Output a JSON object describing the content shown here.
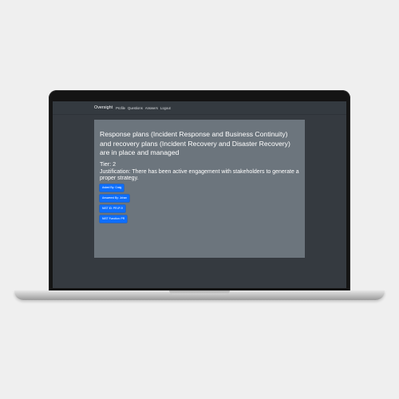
{
  "navbar": {
    "brand": "Oversight",
    "links": [
      "Profile",
      "Questions",
      "Answers",
      "Logout"
    ]
  },
  "card": {
    "heading": "Response plans (Incident Response and Business Continuity) and recovery plans (Incident Recovery and Disaster Recovery) are in place and managed",
    "tier": "Tier: 2",
    "justification": "Justification: There has been active engagement with stakeholders to generate a proper strategy.",
    "buttons": [
      "Asked By: Craig",
      "Answered By: Johan",
      "NIST ID: PR.IP-9",
      "NIST Function: PR"
    ]
  },
  "colors": {
    "background": "#efefef",
    "navbar": "#343a40",
    "card": "#6c757d",
    "button": "#0d6efd"
  }
}
